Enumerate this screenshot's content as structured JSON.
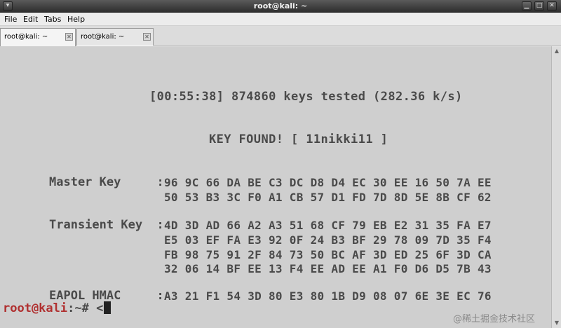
{
  "window": {
    "title": "root@kali: ~",
    "menu_icon": "window-menu-icon",
    "minimize_glyph": "▁",
    "maximize_glyph": "□",
    "close_glyph": "✕"
  },
  "menubar": {
    "items": [
      "File",
      "Edit",
      "Tabs",
      "Help"
    ]
  },
  "tabs": [
    {
      "label": "root@kali: ~",
      "active": true
    },
    {
      "label": "root@kali: ~",
      "active": false
    }
  ],
  "terminal": {
    "status": "[00:55:38] 874860 keys tested (282.36 k/s)",
    "key_found": "KEY FOUND! [ 11nikki11 ]",
    "master_key": {
      "label": "Master Key     :",
      "lines": [
        "96 9C 66 DA BE C3 DC D8 D4 EC 30 EE 16 50 7A EE",
        "50 53 B3 3C F0 A1 CB 57 D1 FD 7D 8D 5E 8B CF 62"
      ]
    },
    "transient_key": {
      "label": "Transient Key  :",
      "lines": [
        "4D 3D AD 66 A2 A3 51 68 CF 79 EB E2 31 35 FA E7",
        "E5 03 EF FA E3 92 0F 24 B3 BF 29 78 09 7D 35 F4",
        "FB 98 75 91 2F 84 73 50 BC AF 3D ED 25 6F 3D CA",
        "32 06 14 BF EE 13 F4 EE AD EE A1 F0 D6 D5 7B 43"
      ]
    },
    "eapol_hmac": {
      "label": "EAPOL HMAC     :",
      "lines": [
        "A3 21 F1 54 3D 80 E3 80 1B D9 08 07 6E 3E EC 76"
      ]
    },
    "prompt_user": "root@kali",
    "prompt_rest": ":~# <",
    "watermark": "@稀土掘金技术社区"
  },
  "colors": {
    "terminal_bg": "#cfcfcf",
    "terminal_fg": "#4a4a4a",
    "prompt_user": "#b03030"
  }
}
